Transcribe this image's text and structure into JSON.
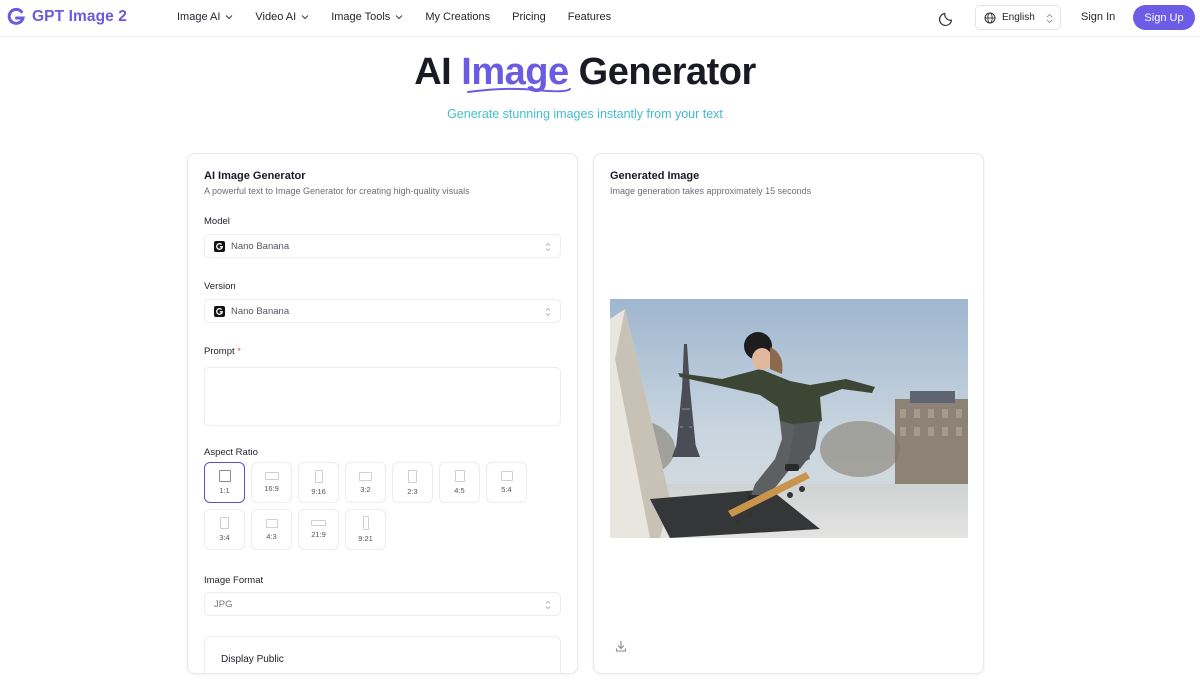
{
  "nav": {
    "logo_text": "GPT Image 2",
    "links": [
      {
        "label": "Image AI",
        "dropdown": true
      },
      {
        "label": "Video AI",
        "dropdown": true
      },
      {
        "label": "Image Tools",
        "dropdown": true
      },
      {
        "label": "My Creations",
        "dropdown": false
      },
      {
        "label": "Pricing",
        "dropdown": false
      },
      {
        "label": "Features",
        "dropdown": false
      }
    ],
    "language": "English",
    "sign_in": "Sign In",
    "sign_up": "Sign Up"
  },
  "hero": {
    "title_before": "AI ",
    "title_accent": "Image",
    "title_after": " Generator",
    "subtitle": "Generate stunning images instantly from your text"
  },
  "generator": {
    "title": "AI Image Generator",
    "description": "A powerful text to Image Generator for creating high-quality visuals",
    "model_label": "Model",
    "model_value": "Nano Banana",
    "version_label": "Version",
    "version_value": "Nano Banana",
    "prompt_label": "Prompt",
    "prompt_required": "*",
    "prompt_value": "",
    "aspect_label": "Aspect Ratio",
    "aspect_ratios": [
      "1:1",
      "16:9",
      "9:16",
      "3:2",
      "2:3",
      "4:5",
      "5:4",
      "3:4",
      "4:3",
      "21:9",
      "9:21"
    ],
    "aspect_selected": "1:1",
    "format_label": "Image Format",
    "format_value": "JPG",
    "display_public_label": "Display Public"
  },
  "output": {
    "title": "Generated Image",
    "description": "Image generation takes approximately 15 seconds"
  },
  "colors": {
    "accent": "#6c5ce7",
    "subtitle_gradient_start": "#3fd6b3",
    "subtitle_gradient_end": "#3d9ee5"
  },
  "icons": {
    "theme": "moon-icon",
    "language": "globe-icon",
    "download": "download-icon",
    "model": "gemini-g-icon"
  }
}
